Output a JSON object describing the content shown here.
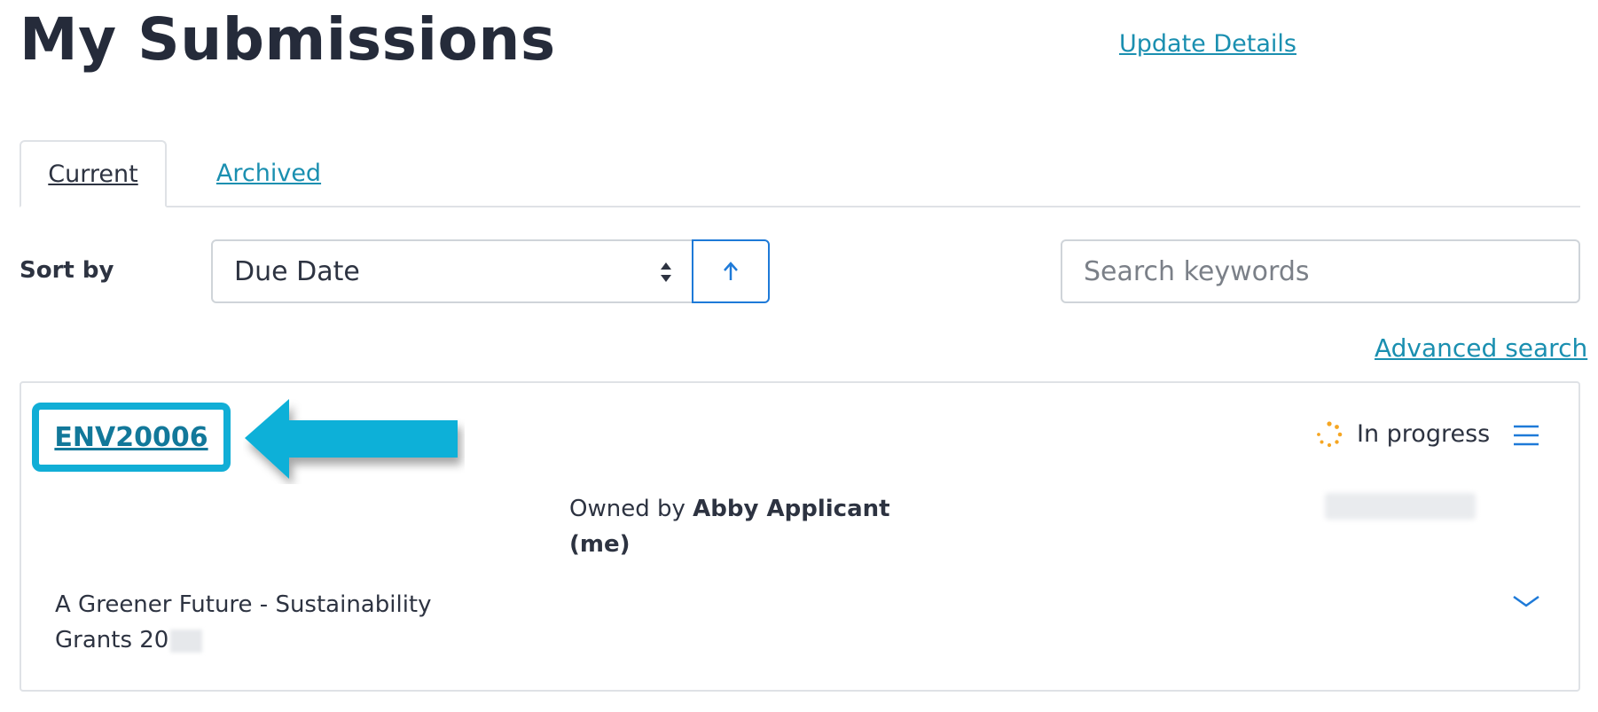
{
  "page": {
    "title": "My Submissions",
    "update_details": "Update Details"
  },
  "tabs": [
    {
      "label": "Current",
      "active": true
    },
    {
      "label": "Archived",
      "active": false
    }
  ],
  "sort": {
    "label": "Sort by",
    "selected": "Due Date",
    "direction": "ascending",
    "direction_icon": "arrow-up-icon"
  },
  "search": {
    "placeholder": "Search keywords",
    "advanced_link": "Advanced search"
  },
  "submission": {
    "reference": "ENV20006",
    "status": "In progress",
    "status_color": "#f5a623",
    "owner_prefix": "Owned by",
    "owner_name": "Abby Applicant",
    "owner_suffix": "(me)",
    "program_line1": "A Greener Future - Sustainability",
    "program_line2": "Grants 20"
  },
  "colors": {
    "link": "#1a8fb0",
    "highlight": "#11aed6",
    "accent_blue": "#1e7ad8",
    "title": "#252b3a"
  }
}
